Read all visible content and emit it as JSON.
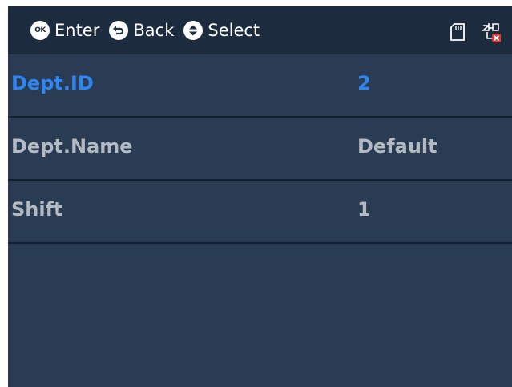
{
  "header": {
    "hints": [
      {
        "icon": "ok-button-icon",
        "label": "Enter"
      },
      {
        "icon": "back-button-icon",
        "label": "Back"
      },
      {
        "icon": "up-down-button-icon",
        "label": "Select"
      }
    ],
    "status_icons": [
      "sd-card-icon",
      "network-disconnected-icon"
    ]
  },
  "fields": [
    {
      "label": "Dept.ID",
      "value": "2",
      "selected": true
    },
    {
      "label": "Dept.Name",
      "value": "Default",
      "selected": false
    },
    {
      "label": "Shift",
      "value": "1",
      "selected": false
    }
  ],
  "colors": {
    "background": "#2a3c54",
    "header_background": "#1d2b3e",
    "selected_text": "#2f86f0",
    "normal_text": "#b4bac2",
    "divider": "#15202e",
    "error_badge": "#e03a3a"
  }
}
